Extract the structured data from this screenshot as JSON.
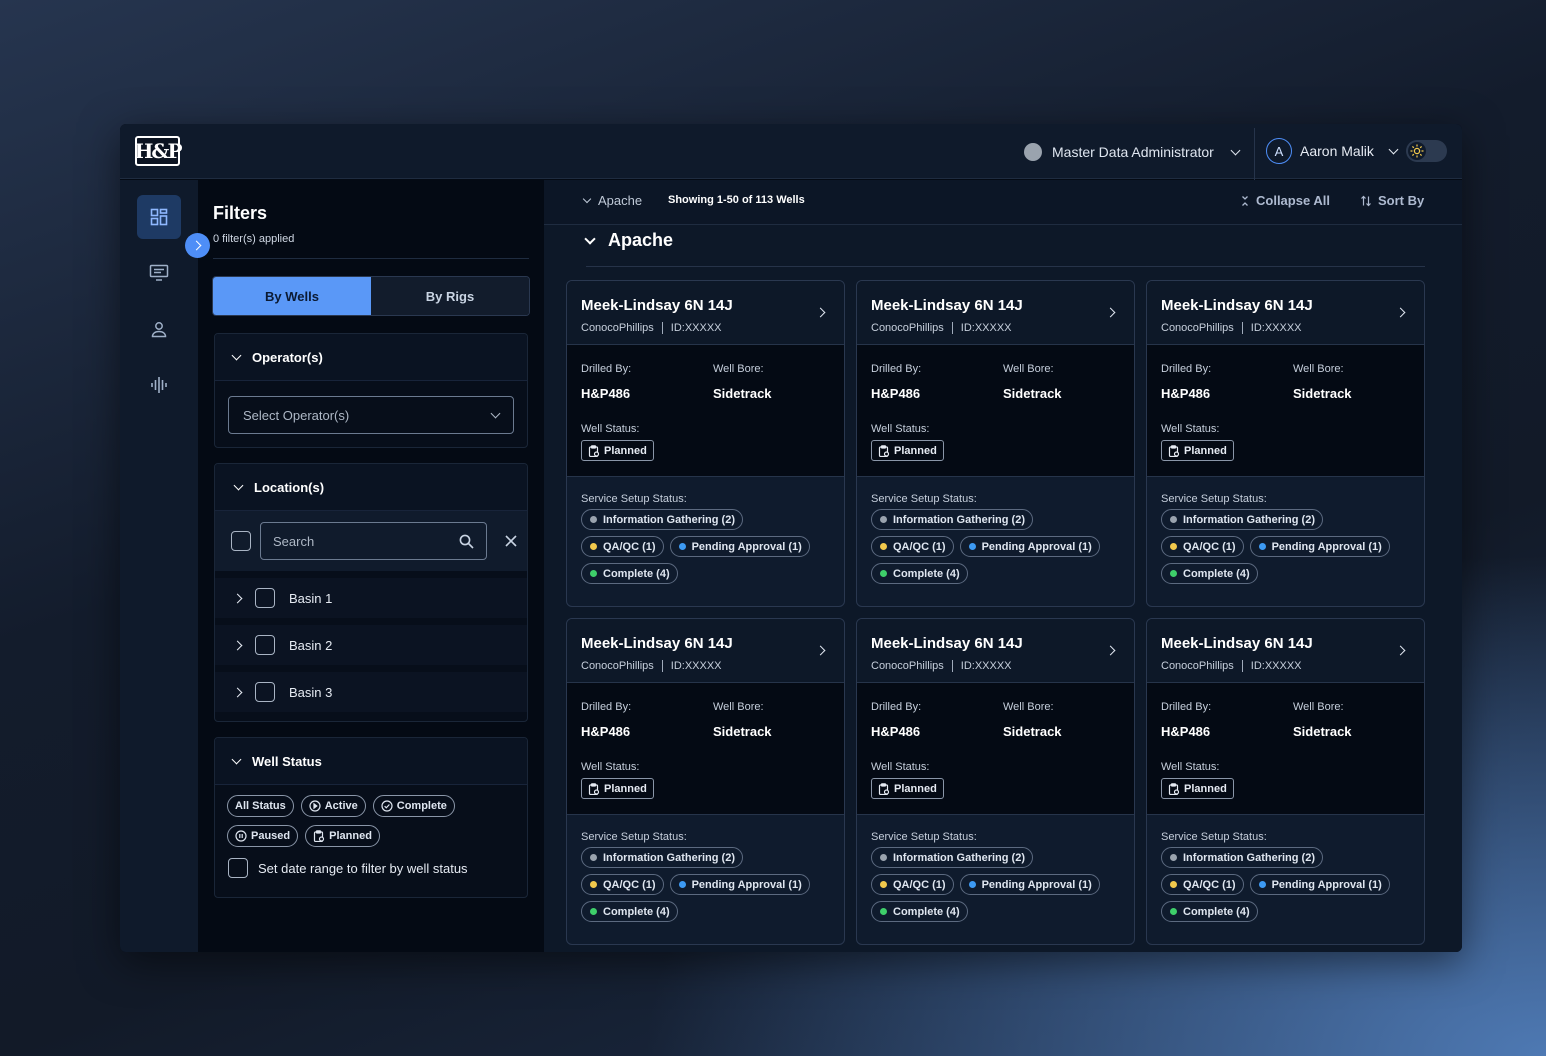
{
  "header": {
    "logo_text": "H&P",
    "role": "Master Data Administrator",
    "user_initial": "A",
    "user_name": "Aaron Malik"
  },
  "rail": {
    "items": [
      "dashboard-icon",
      "monitor-icon",
      "user-icon",
      "waveform-icon"
    ]
  },
  "filters": {
    "title": "Filters",
    "applied": "0 filter(s) applied",
    "tabs": [
      "By Wells",
      "By Rigs"
    ],
    "operator": {
      "title": "Operator(s)",
      "placeholder": "Select Operator(s)"
    },
    "location": {
      "title": "Location(s)",
      "search_placeholder": "Search",
      "basins": [
        "Basin 1",
        "Basin 2",
        "Basin 3"
      ]
    },
    "well_status": {
      "title": "Well Status",
      "chips": [
        "All Status",
        "Active",
        "Complete",
        "Paused",
        "Planned"
      ],
      "date_label": "Set date range to filter by well status"
    }
  },
  "main": {
    "breadcrumb": "Apache",
    "showing": "Showing 1-50 of 113 Wells",
    "collapse_all": "Collapse All",
    "sort_by": "Sort By",
    "group_title": "Apache"
  },
  "card_labels": {
    "drilled_by": "Drilled By:",
    "well_bore": "Well Bore:",
    "well_status": "Well Status:",
    "service_setup": "Service Setup Status:"
  },
  "status_colors": {
    "info": "#9aa3ae",
    "qa": "#f2c94c",
    "pending": "#3d9bf5",
    "complete": "#3ecf6a"
  },
  "cards": [
    {
      "title": "Meek-Lindsay 6N 14J",
      "operator": "ConocoPhillips",
      "id": "ID:XXXXX",
      "drilled_by": "H&P486",
      "well_bore": "Sidetrack",
      "well_status": "Planned",
      "info": "Information Gathering (2)",
      "qa": "QA/QC (1)",
      "pending": "Pending Approval (1)",
      "complete": "Complete (4)"
    },
    {
      "title": "Meek-Lindsay 6N 14J",
      "operator": "ConocoPhillips",
      "id": "ID:XXXXX",
      "drilled_by": "H&P486",
      "well_bore": "Sidetrack",
      "well_status": "Planned",
      "info": "Information Gathering (2)",
      "qa": "QA/QC (1)",
      "pending": "Pending Approval (1)",
      "complete": "Complete (4)"
    },
    {
      "title": "Meek-Lindsay 6N 14J",
      "operator": "ConocoPhillips",
      "id": "ID:XXXXX",
      "drilled_by": "H&P486",
      "well_bore": "Sidetrack",
      "well_status": "Planned",
      "info": "Information Gathering (2)",
      "qa": "QA/QC (1)",
      "pending": "Pending Approval (1)",
      "complete": "Complete (4)"
    },
    {
      "title": "Meek-Lindsay 6N 14J",
      "operator": "ConocoPhillips",
      "id": "ID:XXXXX",
      "drilled_by": "H&P486",
      "well_bore": "Sidetrack",
      "well_status": "Planned",
      "info": "Information Gathering (2)",
      "qa": "QA/QC (1)",
      "pending": "Pending Approval (1)",
      "complete": "Complete (4)"
    },
    {
      "title": "Meek-Lindsay 6N 14J",
      "operator": "ConocoPhillips",
      "id": "ID:XXXXX",
      "drilled_by": "H&P486",
      "well_bore": "Sidetrack",
      "well_status": "Planned",
      "info": "Information Gathering (2)",
      "qa": "QA/QC (1)",
      "pending": "Pending Approval (1)",
      "complete": "Complete (4)"
    },
    {
      "title": "Meek-Lindsay 6N 14J",
      "operator": "ConocoPhillips",
      "id": "ID:XXXXX",
      "drilled_by": "H&P486",
      "well_bore": "Sidetrack",
      "well_status": "Planned",
      "info": "Information Gathering (2)",
      "qa": "QA/QC (1)",
      "pending": "Pending Approval (1)",
      "complete": "Complete (4)"
    }
  ]
}
